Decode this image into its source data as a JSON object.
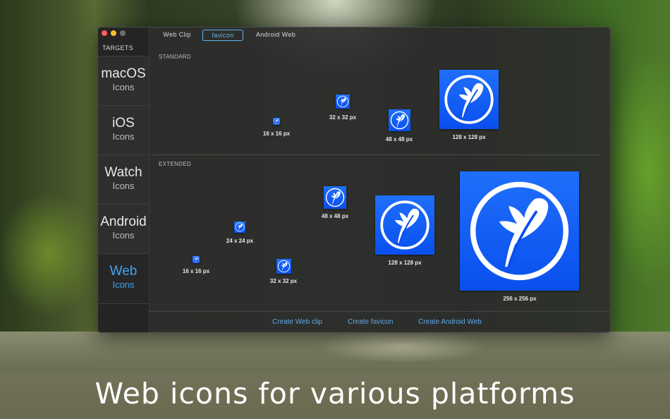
{
  "caption": "Web icons for various platforms",
  "window": {
    "sidebar": {
      "title": "TARGETS",
      "items": [
        {
          "name": "macOS",
          "sub": "Icons"
        },
        {
          "name": "iOS",
          "sub": "Icons"
        },
        {
          "name": "Watch",
          "sub": "Icons"
        },
        {
          "name": "Android",
          "sub": "Icons"
        },
        {
          "name": "Web",
          "sub": "Icons",
          "selected": true
        }
      ]
    },
    "tabs": [
      {
        "label": "Web Clip"
      },
      {
        "label": "favicon",
        "active": true
      },
      {
        "label": "Android Web"
      }
    ],
    "standard": {
      "label": "STANDARD",
      "icons": [
        "16 x 16 px",
        "32 x 32 px",
        "48 x 48 px",
        "128 x 128 px"
      ]
    },
    "extended": {
      "label": "EXTENDED",
      "icons": [
        "16 x 16 px",
        "24 x 24 px",
        "32 x 32 px",
        "48 x 48 px",
        "128 x 128 px",
        "256 x 256 px"
      ]
    },
    "actions": [
      "Create Web clip",
      "Create favicon",
      "Create Android Web"
    ]
  },
  "colors": {
    "accent": "#3ea6f4",
    "icon_blue": "#0a4fee"
  },
  "icon_names": {
    "app_icon": "feather-circle-icon"
  }
}
